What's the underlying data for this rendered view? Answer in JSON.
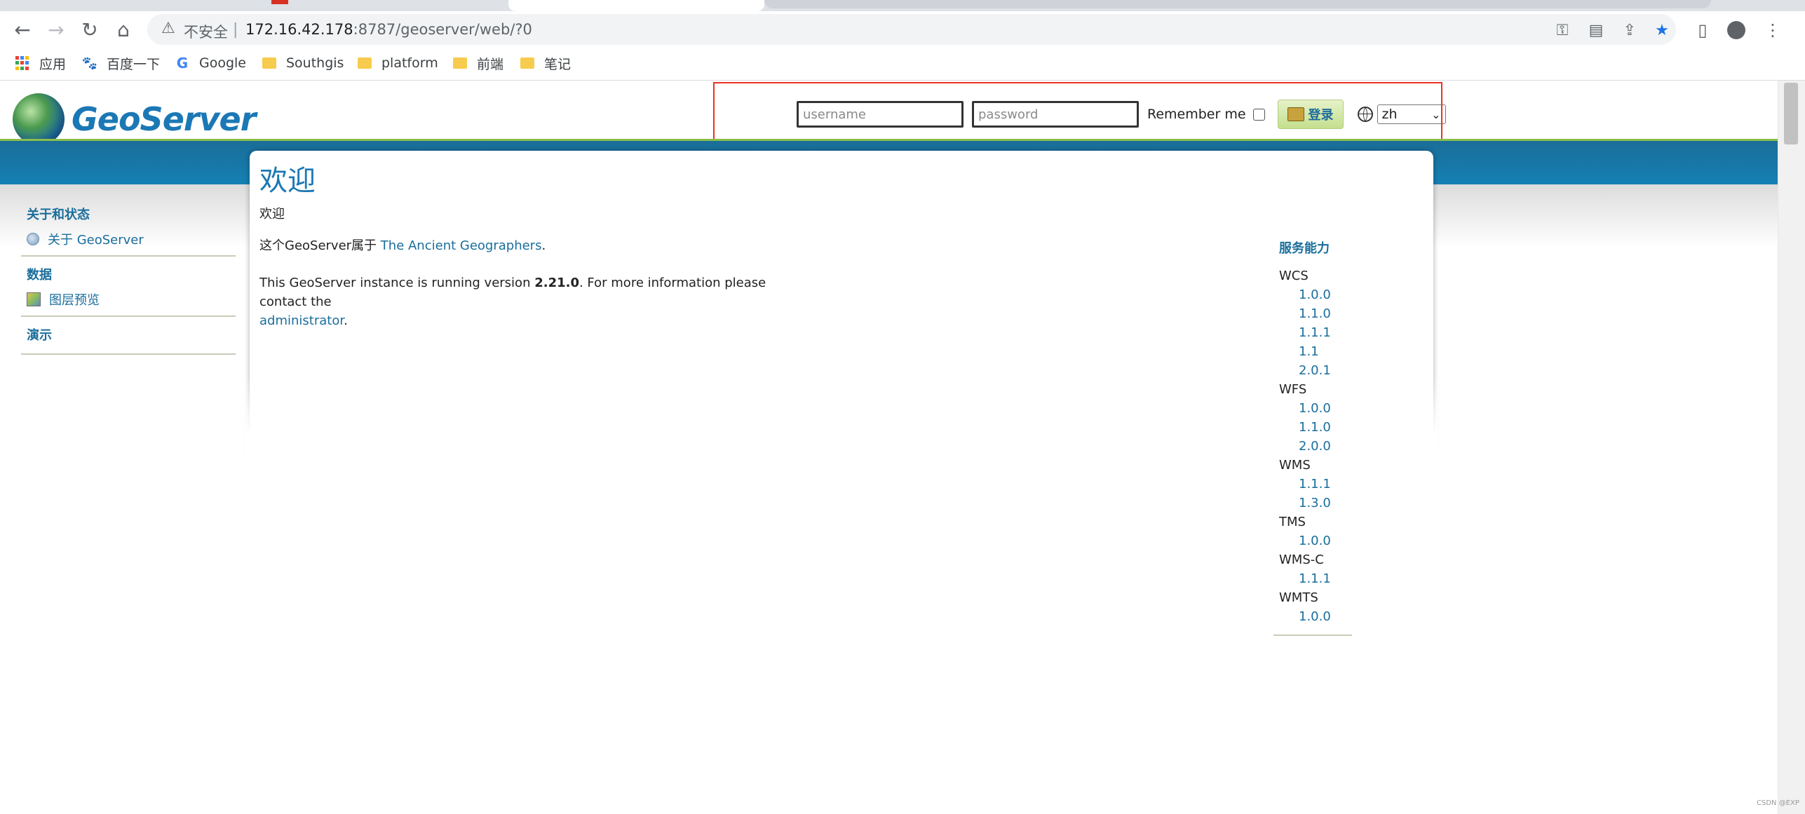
{
  "browser": {
    "security_label": "不安全",
    "separator": "|",
    "url_host": "172.16.42.178",
    "url_rest": ":8787/geoserver/web/?0"
  },
  "bookmarks": [
    {
      "label": "应用",
      "icon": "apps-grid-icon"
    },
    {
      "label": "百度一下",
      "icon": "baidu-paw-icon"
    },
    {
      "label": "Google",
      "icon": "google-g-icon"
    },
    {
      "label": "Southgis",
      "icon": "folder-icon"
    },
    {
      "label": "platform",
      "icon": "folder-icon"
    },
    {
      "label": "前端",
      "icon": "folder-icon"
    },
    {
      "label": "笔记",
      "icon": "folder-icon"
    }
  ],
  "header": {
    "logo_text": "GeoServer",
    "login": {
      "username_placeholder": "username",
      "password_placeholder": "password",
      "remember_label": "Remember me",
      "login_button": "登录",
      "language": "zh"
    }
  },
  "sidebar": {
    "sections": [
      {
        "title": "关于和状态",
        "items": [
          {
            "label": "关于 GeoServer",
            "icon": "info-icon"
          }
        ]
      },
      {
        "title": "数据",
        "items": [
          {
            "label": "图层预览",
            "icon": "map-icon"
          }
        ]
      },
      {
        "title": "演示",
        "items": []
      }
    ]
  },
  "main": {
    "title": "欢迎",
    "subtitle": "欢迎",
    "owner_prefix": "这个GeoServer属于 ",
    "owner_link": "The Ancient Geographers",
    "owner_suffix": ".",
    "version_prefix": "This GeoServer instance is running version ",
    "version": "2.21.0",
    "version_mid": ". For more information please contact the",
    "admin_link": "administrator",
    "admin_suffix": "."
  },
  "capabilities": {
    "title": "服务能力",
    "services": [
      {
        "name": "WCS",
        "versions": [
          "1.0.0",
          "1.1.0",
          "1.1.1",
          "1.1",
          "2.0.1"
        ]
      },
      {
        "name": "WFS",
        "versions": [
          "1.0.0",
          "1.1.0",
          "2.0.0"
        ]
      },
      {
        "name": "WMS",
        "versions": [
          "1.1.1",
          "1.3.0"
        ]
      },
      {
        "name": "TMS",
        "versions": [
          "1.0.0"
        ]
      },
      {
        "name": "WMS-C",
        "versions": [
          "1.1.1"
        ]
      },
      {
        "name": "WMTS",
        "versions": [
          "1.0.0"
        ]
      }
    ]
  },
  "watermark": "CSDN @EXP"
}
